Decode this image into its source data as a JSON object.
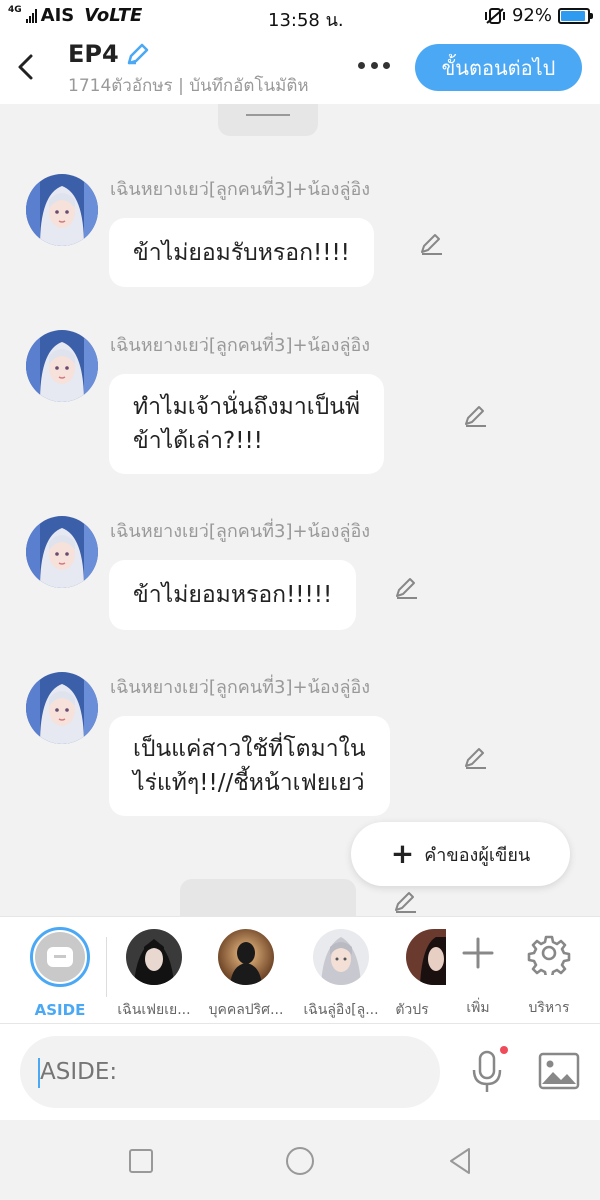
{
  "status_bar": {
    "network": "4G",
    "carrier": "AIS",
    "volte": "VoLTE",
    "time": "13:58 น.",
    "battery": "92%",
    "battery_level": 0.92
  },
  "header": {
    "title": "EP4",
    "subtitle": "1714ตัวอักษร | บันทึกอัตโนมัติห",
    "next_button": "ขั้นตอนต่อไป"
  },
  "messages": [
    {
      "sender": "เฉินหยางเยว่[ลูกคนที่3]+น้องลู่อิง",
      "lines": [
        "ข้าไม่ยอมรับหรอก!!!!"
      ]
    },
    {
      "sender": "เฉินหยางเยว่[ลูกคนที่3]+น้องลู่อิง",
      "lines": [
        "ทำไมเจ้านั่นถึงมาเป็นพี่",
        "ข้าได้เล่า?!!!"
      ]
    },
    {
      "sender": "เฉินหยางเยว่[ลูกคนที่3]+น้องลู่อิง",
      "lines": [
        "ข้าไม่ยอมหรอก!!!!!"
      ]
    },
    {
      "sender": "เฉินหยางเยว่[ลูกคนที่3]+น้องลู่อิง",
      "lines": [
        "เป็นแค่สาวใช้ที่โตมาใน",
        "ไร่แท้ๆ!!//ชี้หน้าเฟยเยว่"
      ]
    }
  ],
  "fab": {
    "label": "คำของผู้เขียน"
  },
  "characters": [
    {
      "label": "ASIDE"
    },
    {
      "label": "เฉินเฟยเย..."
    },
    {
      "label": "บุคคลปริศ..."
    },
    {
      "label": "เฉินลู่อิง[ลู..."
    },
    {
      "label": "ตัวปร"
    }
  ],
  "actions": {
    "add_label": "เพิ่ม",
    "manage_label": "บริหาร"
  },
  "input": {
    "placeholder": "ASIDE:"
  },
  "colors": {
    "accent": "#4aa8f4",
    "background": "#f2f2f2",
    "bubble": "#ffffff"
  }
}
